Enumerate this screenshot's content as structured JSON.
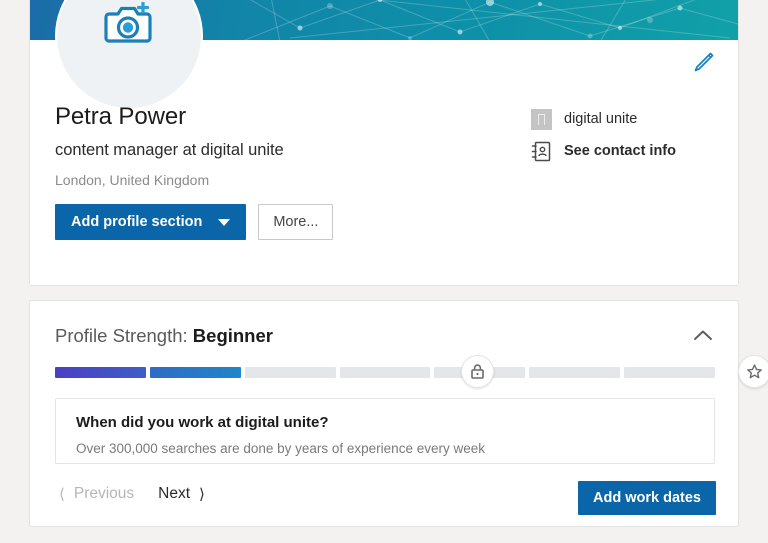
{
  "theme": {
    "accent": "#0a66a8",
    "banner_left": "#1b6ca8",
    "banner_right": "#11a0a8",
    "page_bg": "#f3f2f0",
    "card_bg": "#ffffff",
    "muted_text": "#8b8b8b",
    "progress_purple": "#4b3fc4",
    "progress_blue": "#1f86c8",
    "progress_empty": "#e3e7ea"
  },
  "profile": {
    "avatar_icon": "camera-add-icon",
    "edit_icon": "pencil-edit-icon",
    "name": "Petra Power",
    "headline": "content manager at digital unite",
    "location": "London, United Kingdom",
    "actions": {
      "add_section_label": "Add profile section",
      "add_section_caret": "chevron-down-icon",
      "more_label": "More..."
    },
    "contact": [
      {
        "icon": "company-logo-icon",
        "label": "digital unite",
        "bold": false
      },
      {
        "icon": "contact-card-icon",
        "label": "See contact info",
        "bold": true
      }
    ]
  },
  "strength": {
    "label_prefix": "Profile Strength: ",
    "level": "Beginner",
    "collapse_icon": "chevron-up-icon",
    "progress": {
      "total_segments": 7,
      "filled_segments": 2,
      "percent": 28,
      "segments": [
        {
          "state": "filled",
          "color_from": "#4b3fc4",
          "color_to": "#3f5ec8"
        },
        {
          "state": "filled",
          "color_from": "#2f6cc6",
          "color_to": "#1f86c8"
        },
        {
          "state": "empty",
          "color_from": "#e3e7ea",
          "color_to": "#e3e7ea"
        },
        {
          "state": "empty",
          "color_from": "#e3e7ea",
          "color_to": "#e3e7ea"
        },
        {
          "state": "empty",
          "color_from": "#e3e7ea",
          "color_to": "#e3e7ea"
        },
        {
          "state": "empty",
          "color_from": "#e3e7ea",
          "color_to": "#e3e7ea"
        },
        {
          "state": "empty",
          "color_from": "#e3e7ea",
          "color_to": "#e3e7ea"
        }
      ],
      "milestones": [
        {
          "icon": "lock-icon",
          "position_percent": 64
        },
        {
          "icon": "star-icon",
          "position_percent": 106
        }
      ]
    },
    "question": {
      "title": "When did you work at digital unite?",
      "subtitle": "Over 300,000 searches are done by years of experience every week"
    },
    "footer": {
      "previous_label": "Previous",
      "previous_icon": "chevron-left-icon",
      "previous_disabled": true,
      "next_label": "Next",
      "next_icon": "chevron-right-icon",
      "cta_label": "Add work dates"
    }
  }
}
